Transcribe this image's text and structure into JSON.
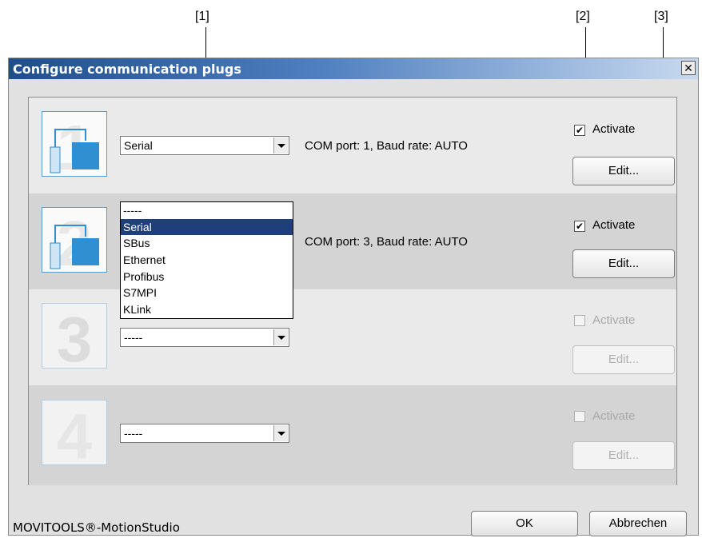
{
  "callouts": [
    "[1]",
    "[2]",
    "[3]"
  ],
  "dialog": {
    "title": "Configure communication plugs",
    "close_glyph": "✕"
  },
  "plugs": [
    {
      "number": "1",
      "protocol": "Serial",
      "status": "COM port: 1, Baud rate: AUTO",
      "activate_label": "Activate",
      "activate_checked": true,
      "enabled": true,
      "edit_label": "Edit..."
    },
    {
      "number": "2",
      "protocol": "",
      "status": "COM port: 3, Baud rate: AUTO",
      "activate_label": "Activate",
      "activate_checked": true,
      "enabled": true,
      "edit_label": "Edit..."
    },
    {
      "number": "3",
      "protocol": "-----",
      "status": "",
      "activate_label": "Activate",
      "activate_checked": false,
      "enabled": false,
      "edit_label": "Edit..."
    },
    {
      "number": "4",
      "protocol": "-----",
      "status": "",
      "activate_label": "Activate",
      "activate_checked": false,
      "enabled": false,
      "edit_label": "Edit..."
    }
  ],
  "dropdown": {
    "options": [
      "-----",
      "Serial",
      "SBus",
      "Ethernet",
      "Profibus",
      "S7MPI",
      "KLink"
    ],
    "selected": "Serial"
  },
  "footer": {
    "brand": "MOVITOOLS®-MotionStudio",
    "ok_label": "OK",
    "cancel_label": "Abbrechen"
  },
  "icons": {
    "close": "close-icon",
    "plug": "network-plug-icon",
    "checkbox_checked": "✔",
    "combo_arrow": "chevron-down-icon"
  },
  "colors": {
    "title_gradient_start": "#1f4e8c",
    "title_gradient_end": "#c7d9ef",
    "selection": "#1f3f7a",
    "icon_blue": "#2f8fd0",
    "row_light": "#eaeaea",
    "row_dark": "#d4d4d4"
  }
}
